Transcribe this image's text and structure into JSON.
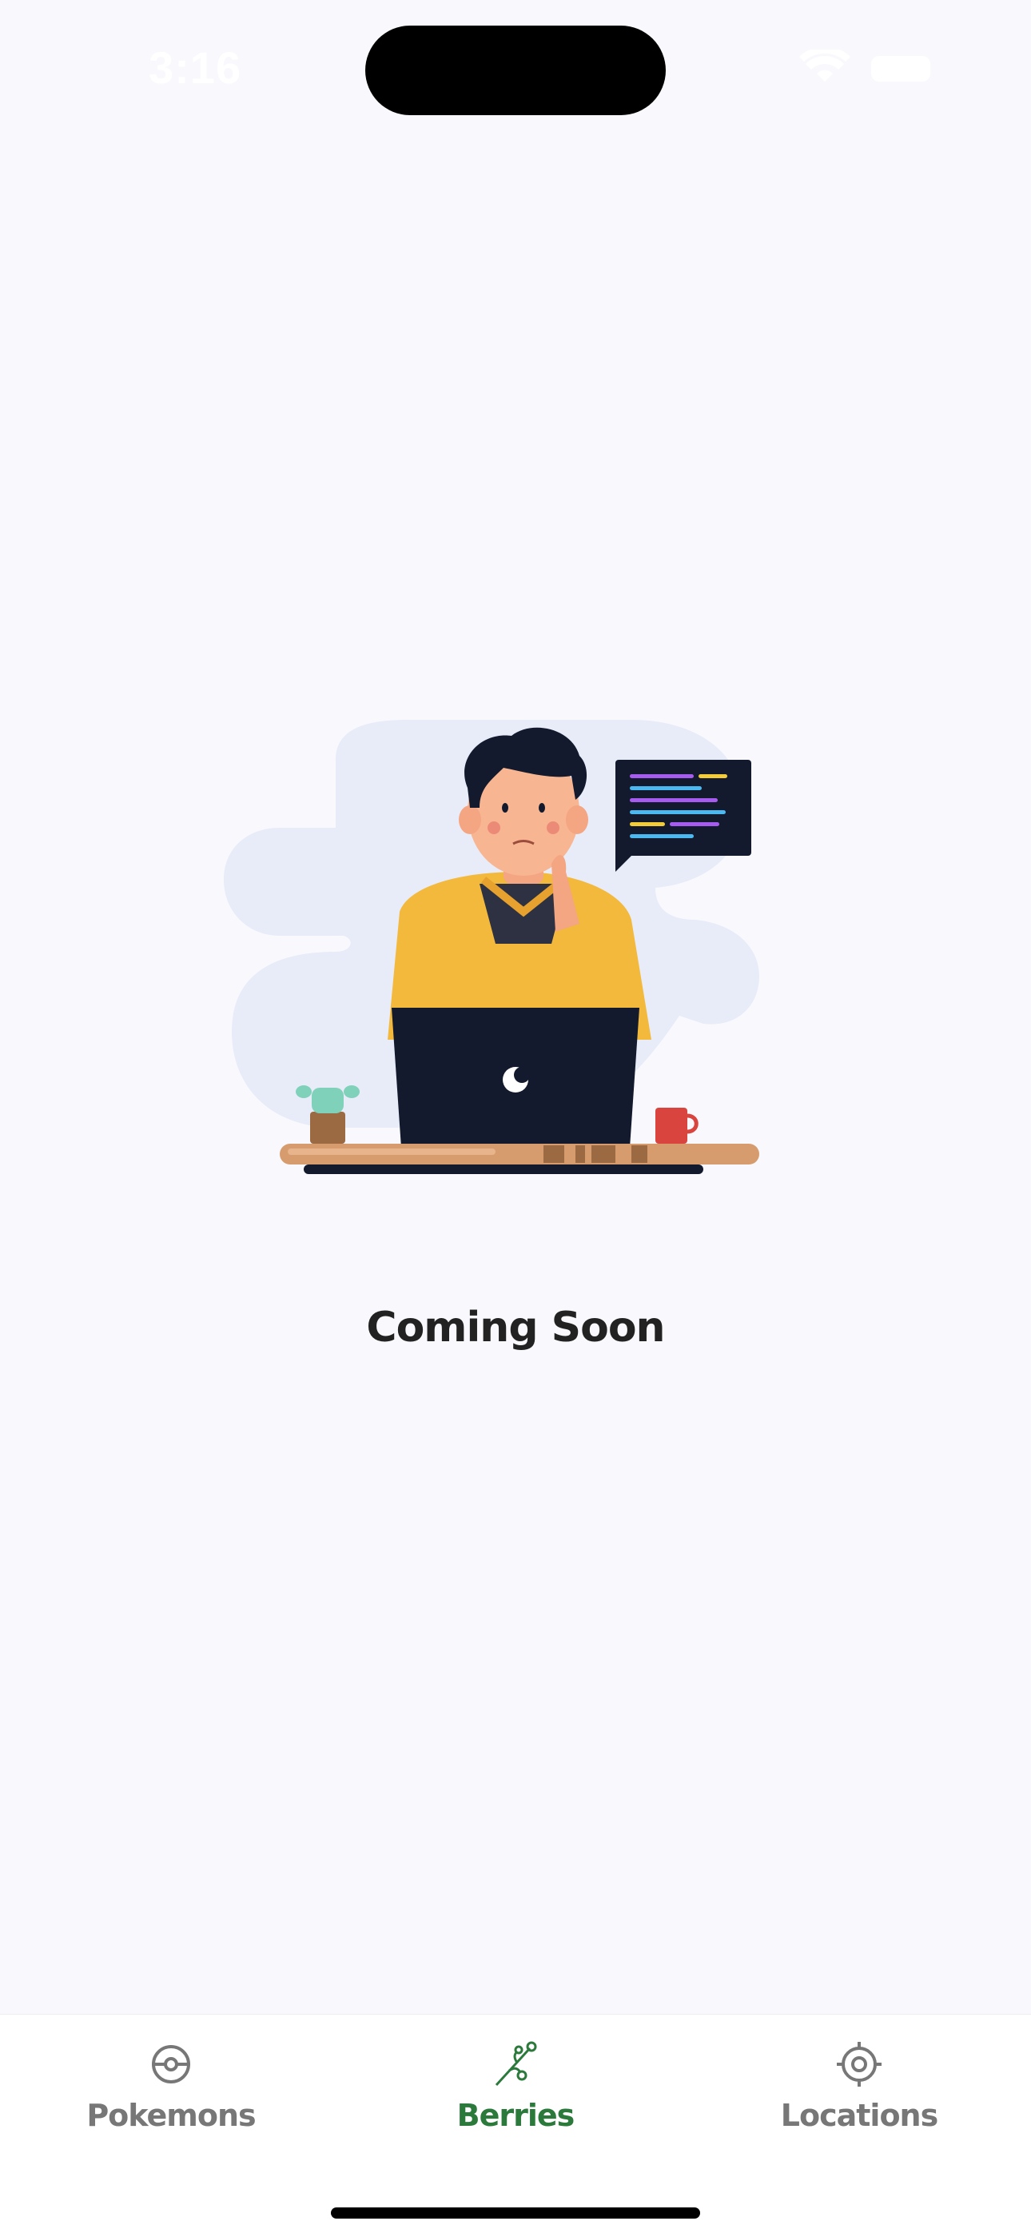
{
  "status_bar": {
    "time": "3:16"
  },
  "main": {
    "message": "Coming Soon",
    "illustration_icon": "developer-at-laptop-illustration"
  },
  "tab_bar": {
    "tabs": [
      {
        "label": "Pokemons",
        "icon": "pokeball-icon",
        "active": false
      },
      {
        "label": "Berries",
        "icon": "berry-branch-icon",
        "active": true
      },
      {
        "label": "Locations",
        "icon": "location-target-icon",
        "active": false
      }
    ],
    "active_color": "#2b7a3c",
    "inactive_color": "#777777"
  }
}
